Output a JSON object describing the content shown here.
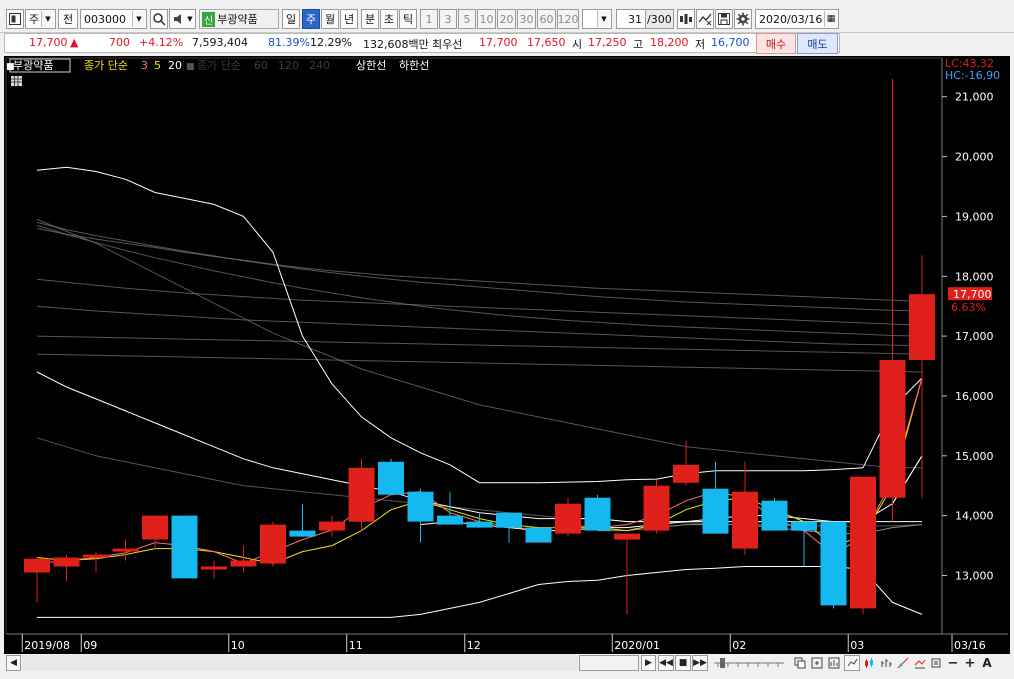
{
  "toolbar": {
    "market": "주",
    "period_prefix": "전",
    "code": "003000",
    "credit_badge": "신",
    "stock_name": "부광약품",
    "periods": [
      "일",
      "주",
      "월",
      "년",
      "분",
      "초",
      "틱"
    ],
    "active_period": "주",
    "tick_intervals": [
      "1",
      "3",
      "5",
      "10",
      "20",
      "30",
      "60",
      "120"
    ],
    "count": "31",
    "count_total": "/300",
    "date": "2020/03/16"
  },
  "quote": {
    "price": "17,700",
    "change_sign": "▲",
    "change": "700",
    "change_rate": "+4.12%",
    "volume": "7,593,404",
    "volume_ratio": "81.39%",
    "turnover": "12.29%",
    "amount": "132,608백만",
    "best_label": "최우선",
    "best_ask": "17,700",
    "best_bid": "17,650",
    "open_label": "시",
    "open": "17,250",
    "high_label": "고",
    "high": "18,200",
    "low_label": "저",
    "low": "16,700",
    "buy_label": "매수",
    "sell_label": "매도"
  },
  "chart_title": {
    "name": "부광약품",
    "price_label": "종가 단순",
    "ma_periods": [
      "3",
      "5",
      "20"
    ],
    "ma_extra": [
      "종가 단순",
      "60",
      "120",
      "240"
    ],
    "upper_limit": "상한선",
    "lower_limit": "하한선"
  },
  "axis_flags": {
    "lc": "LC:43,32",
    "hc": "HC:-16,90"
  },
  "current_price_tag": {
    "value": "17,700",
    "change": "6.63%"
  },
  "colors": {
    "up": "#e0201a",
    "down": "#16b9ef",
    "ma3": "#ff6f6f",
    "ma5": "#f5e400",
    "ma20": "#ffffff",
    "background": "#000000",
    "axis_text": "#ffffff"
  },
  "chart_data": {
    "type": "candlestick",
    "timeframe": "weekly",
    "ylim": [
      12300,
      21300
    ],
    "yticks": [
      "13,000",
      "14,000",
      "15,000",
      "16,000",
      "17,000",
      "18,000",
      "19,000",
      "20,000",
      "21,000"
    ],
    "yticks_values": [
      13000,
      14000,
      15000,
      16000,
      17000,
      18000,
      19000,
      20000,
      21000
    ],
    "x_labels": [
      {
        "label": "2019/08",
        "index": 0
      },
      {
        "label": "09",
        "index": 2
      },
      {
        "label": "10",
        "index": 7
      },
      {
        "label": "11",
        "index": 11
      },
      {
        "label": "12",
        "index": 15
      },
      {
        "label": "2020/01",
        "index": 20
      },
      {
        "label": "02",
        "index": 24
      },
      {
        "label": "03",
        "index": 28
      },
      {
        "label": "03/16",
        "index": 32
      }
    ],
    "candles": [
      {
        "o": 13050,
        "h": 13310,
        "l": 12550,
        "c": 13280
      },
      {
        "o": 13150,
        "h": 13350,
        "l": 12900,
        "c": 13300
      },
      {
        "o": 13300,
        "h": 13400,
        "l": 13050,
        "c": 13350
      },
      {
        "o": 13400,
        "h": 13600,
        "l": 13250,
        "c": 13450
      },
      {
        "o": 13600,
        "h": 13850,
        "l": 13450,
        "c": 14000
      },
      {
        "o": 14000,
        "h": 14000,
        "l": 12950,
        "c": 12950
      },
      {
        "o": 13100,
        "h": 13250,
        "l": 12950,
        "c": 13150
      },
      {
        "o": 13150,
        "h": 13500,
        "l": 13050,
        "c": 13250
      },
      {
        "o": 13200,
        "h": 13900,
        "l": 13150,
        "c": 13850
      },
      {
        "o": 13750,
        "h": 14200,
        "l": 13650,
        "c": 13650
      },
      {
        "o": 13750,
        "h": 14000,
        "l": 13650,
        "c": 13900
      },
      {
        "o": 13900,
        "h": 14950,
        "l": 13750,
        "c": 14800
      },
      {
        "o": 14900,
        "h": 14950,
        "l": 14350,
        "c": 14350
      },
      {
        "o": 14400,
        "h": 14450,
        "l": 13550,
        "c": 13900
      },
      {
        "o": 14000,
        "h": 14400,
        "l": 13850,
        "c": 13850
      },
      {
        "o": 13900,
        "h": 14050,
        "l": 13800,
        "c": 13800
      },
      {
        "o": 14050,
        "h": 14050,
        "l": 13550,
        "c": 13800
      },
      {
        "o": 13800,
        "h": 13800,
        "l": 13600,
        "c": 13550
      },
      {
        "o": 13700,
        "h": 14300,
        "l": 13650,
        "c": 14200
      },
      {
        "o": 14300,
        "h": 14350,
        "l": 13800,
        "c": 13750
      },
      {
        "o": 13600,
        "h": 13700,
        "l": 12350,
        "c": 13700
      },
      {
        "o": 13750,
        "h": 14600,
        "l": 13700,
        "c": 14500
      },
      {
        "o": 14550,
        "h": 15250,
        "l": 14500,
        "c": 14850
      },
      {
        "o": 14450,
        "h": 14900,
        "l": 13700,
        "c": 13700
      },
      {
        "o": 13450,
        "h": 14900,
        "l": 13350,
        "c": 14400
      },
      {
        "o": 14250,
        "h": 14300,
        "l": 13750,
        "c": 13750
      },
      {
        "o": 13900,
        "h": 13900,
        "l": 13150,
        "c": 13750
      },
      {
        "o": 13900,
        "h": 13900,
        "l": 12450,
        "c": 12500
      },
      {
        "o": 12450,
        "h": 14650,
        "l": 12350,
        "c": 14650
      },
      {
        "o": 14300,
        "h": 21300,
        "l": 13900,
        "c": 16600
      },
      {
        "o": 16600,
        "h": 18350,
        "l": 14300,
        "c": 17700
      }
    ],
    "ma3": [
      13200,
      13250,
      13300,
      13380,
      13550,
      13500,
      13400,
      13200,
      13400,
      13600,
      13760,
      14120,
      14350,
      14400,
      14050,
      13900,
      13820,
      13750,
      13850,
      13800,
      13850,
      14000,
      14250,
      14400,
      14300,
      13950,
      13750,
      13350,
      13650,
      14600,
      16300
    ],
    "ma5": [
      13300,
      13250,
      13280,
      13350,
      13450,
      13450,
      13400,
      13300,
      13200,
      13400,
      13500,
      13750,
      14100,
      14250,
      14100,
      13950,
      13850,
      13800,
      13800,
      13800,
      13750,
      13850,
      14100,
      14250,
      14300,
      14100,
      13900,
      13500,
      13650,
      14500,
      16300
    ],
    "ma20": [
      null,
      null,
      null,
      null,
      null,
      null,
      null,
      null,
      null,
      null,
      null,
      null,
      null,
      13850,
      13900,
      13850,
      13800,
      13750,
      13750,
      13800,
      13800,
      13850,
      13900,
      13950,
      14000,
      14000,
      13950,
      13900,
      13900,
      14200,
      15000
    ],
    "ma60": [
      null,
      null,
      null,
      null,
      null,
      null,
      null,
      null,
      null,
      null,
      null,
      null,
      null,
      null,
      null,
      null,
      null,
      null,
      null,
      13750,
      13750,
      13800,
      13850,
      13850,
      13850,
      13800,
      13750,
      13700,
      13700,
      13800,
      13850
    ],
    "bands": {
      "upper": [
        19770,
        19820,
        19750,
        19620,
        19400,
        19300,
        19200,
        19000,
        18400,
        17000,
        16200,
        15650,
        15300,
        15050,
        14850,
        14550,
        14550,
        14550,
        14560,
        14570,
        14600,
        14610,
        14700,
        14750,
        14750,
        14750,
        14750,
        14770,
        14800,
        15800,
        16300
      ],
      "lower": [
        12300,
        12300,
        12300,
        12300,
        12300,
        12300,
        12300,
        12300,
        12300,
        12300,
        12300,
        12300,
        12300,
        12350,
        12450,
        12550,
        12700,
        12850,
        12900,
        12920,
        13000,
        13050,
        13100,
        13120,
        13150,
        13150,
        13150,
        13150,
        13100,
        12550,
        12350
      ],
      "white_low": [
        16400,
        16150,
        15950,
        15750,
        15550,
        15350,
        15150,
        14950,
        14800,
        14700,
        14600,
        14500,
        14400,
        14250,
        14150,
        14050,
        14000,
        13950,
        13950,
        13950,
        13900,
        13900,
        13900,
        13900,
        13900,
        13900,
        13900,
        13900,
        13900,
        13900,
        13900
      ],
      "white_mid": [
        null,
        null,
        null,
        null,
        null,
        null,
        null,
        null,
        null,
        null,
        null,
        null,
        null,
        null,
        null,
        null,
        null,
        null,
        null,
        null,
        null,
        null,
        null,
        null,
        null,
        null,
        null,
        null,
        null,
        14200,
        15000
      ]
    },
    "gray_lines": [
      [
        18800,
        18700,
        18620,
        18550,
        18480,
        18400,
        18330,
        18270,
        18200,
        18140,
        18090,
        18050,
        18010,
        17980,
        17950,
        17920,
        17890,
        17860,
        17830,
        17800,
        17780,
        17760,
        17740,
        17720,
        17700,
        17680,
        17660,
        17640,
        17620,
        17600,
        17580
      ],
      [
        18900,
        18780,
        18680,
        18590,
        18500,
        18420,
        18340,
        18260,
        18190,
        18120,
        18060,
        18000,
        17950,
        17900,
        17860,
        17820,
        17780,
        17740,
        17700,
        17660,
        17630,
        17600,
        17570,
        17550,
        17530,
        17510,
        17490,
        17470,
        17450,
        17430,
        17420
      ],
      [
        18850,
        18700,
        18560,
        18430,
        18310,
        18200,
        18090,
        17990,
        17890,
        17800,
        17720,
        17640,
        17570,
        17500,
        17440,
        17390,
        17340,
        17300,
        17260,
        17230,
        17200,
        17170,
        17150,
        17130,
        17110,
        17090,
        17070,
        17050,
        17030,
        17010,
        17000
      ],
      [
        17950,
        17900,
        17850,
        17800,
        17760,
        17720,
        17690,
        17660,
        17630,
        17600,
        17580,
        17560,
        17540,
        17520,
        17500,
        17480,
        17460,
        17440,
        17420,
        17400,
        17380,
        17360,
        17340,
        17320,
        17300,
        17280,
        17260,
        17240,
        17220,
        17200,
        17180
      ],
      [
        17500,
        17460,
        17420,
        17390,
        17360,
        17330,
        17300,
        17270,
        17250,
        17230,
        17210,
        17190,
        17170,
        17150,
        17130,
        17110,
        17090,
        17070,
        17050,
        17030,
        17010,
        16990,
        16970,
        16950,
        16930,
        16910,
        16890,
        16870,
        16860,
        16850,
        16840
      ],
      [
        17000,
        16990,
        16980,
        16970,
        16960,
        16950,
        16940,
        16930,
        16920,
        16910,
        16900,
        16890,
        16880,
        16870,
        16860,
        16850,
        16840,
        16830,
        16820,
        16810,
        16800,
        16790,
        16780,
        16770,
        16760,
        16750,
        16740,
        16730,
        16720,
        16710,
        16700
      ],
      [
        16700,
        16690,
        16680,
        16670,
        16660,
        16650,
        16640,
        16630,
        16620,
        16610,
        16600,
        16590,
        16580,
        16570,
        16560,
        16550,
        16540,
        16530,
        16520,
        16510,
        16500,
        16490,
        16480,
        16470,
        16460,
        16450,
        16440,
        16430,
        16420,
        16410,
        16400
      ],
      [
        18950,
        18750,
        18550,
        18300,
        18050,
        17800,
        17550,
        17300,
        17050,
        16850,
        16650,
        16450,
        16300,
        16150,
        16000,
        15850,
        15750,
        15650,
        15550,
        15450,
        15350,
        15250,
        15150,
        15100,
        15050,
        15000,
        14950,
        14900,
        14850,
        14800,
        14800
      ],
      [
        15300,
        15150,
        15000,
        14900,
        14800,
        14700,
        14600,
        14500,
        14450,
        14400,
        14350,
        14300,
        14250,
        14200,
        14150,
        14100,
        14050,
        14000,
        13950,
        13950,
        13900,
        13900,
        13880,
        13860,
        13850,
        13840,
        13830,
        13820,
        13820,
        13830,
        13850
      ]
    ]
  },
  "scroll": {
    "buttons": [
      "◀",
      "▶",
      "◀◀",
      "■",
      "▶▶"
    ]
  }
}
